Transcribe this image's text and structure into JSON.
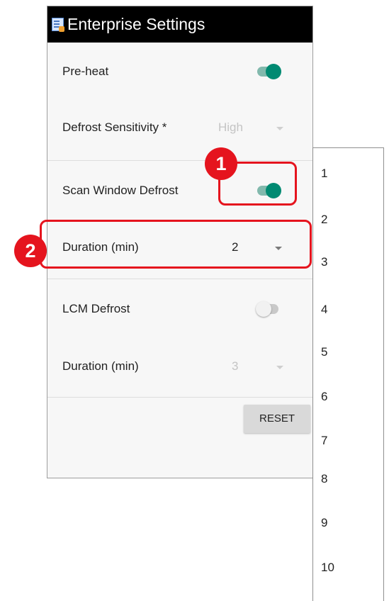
{
  "window": {
    "title": "Enterprise Settings",
    "icon": "settings-app-icon"
  },
  "settings": {
    "preheat": {
      "label": "Pre-heat",
      "enabled": true
    },
    "defrost_sensitivity": {
      "label": "Defrost Sensitivity *",
      "value": "High",
      "disabled": true
    },
    "scan_window_defrost": {
      "label": "Scan Window Defrost",
      "enabled": true
    },
    "scan_duration": {
      "label": "Duration (min)",
      "value": "2"
    },
    "lcm_defrost": {
      "label": "LCM Defrost",
      "enabled": false
    },
    "lcm_duration": {
      "label": "Duration (min)",
      "value": "3",
      "disabled": true
    }
  },
  "actions": {
    "reset_label": "RESET"
  },
  "dropdown": {
    "options": [
      "1",
      "2",
      "3",
      "4",
      "5",
      "6",
      "7",
      "8",
      "9",
      "10"
    ]
  },
  "callouts": [
    {
      "number": "1"
    },
    {
      "number": "2"
    }
  ],
  "colors": {
    "accent": "#008a72",
    "accent_track": "#82b9ad",
    "callout": "#e5141e",
    "titlebar": "#000000"
  }
}
